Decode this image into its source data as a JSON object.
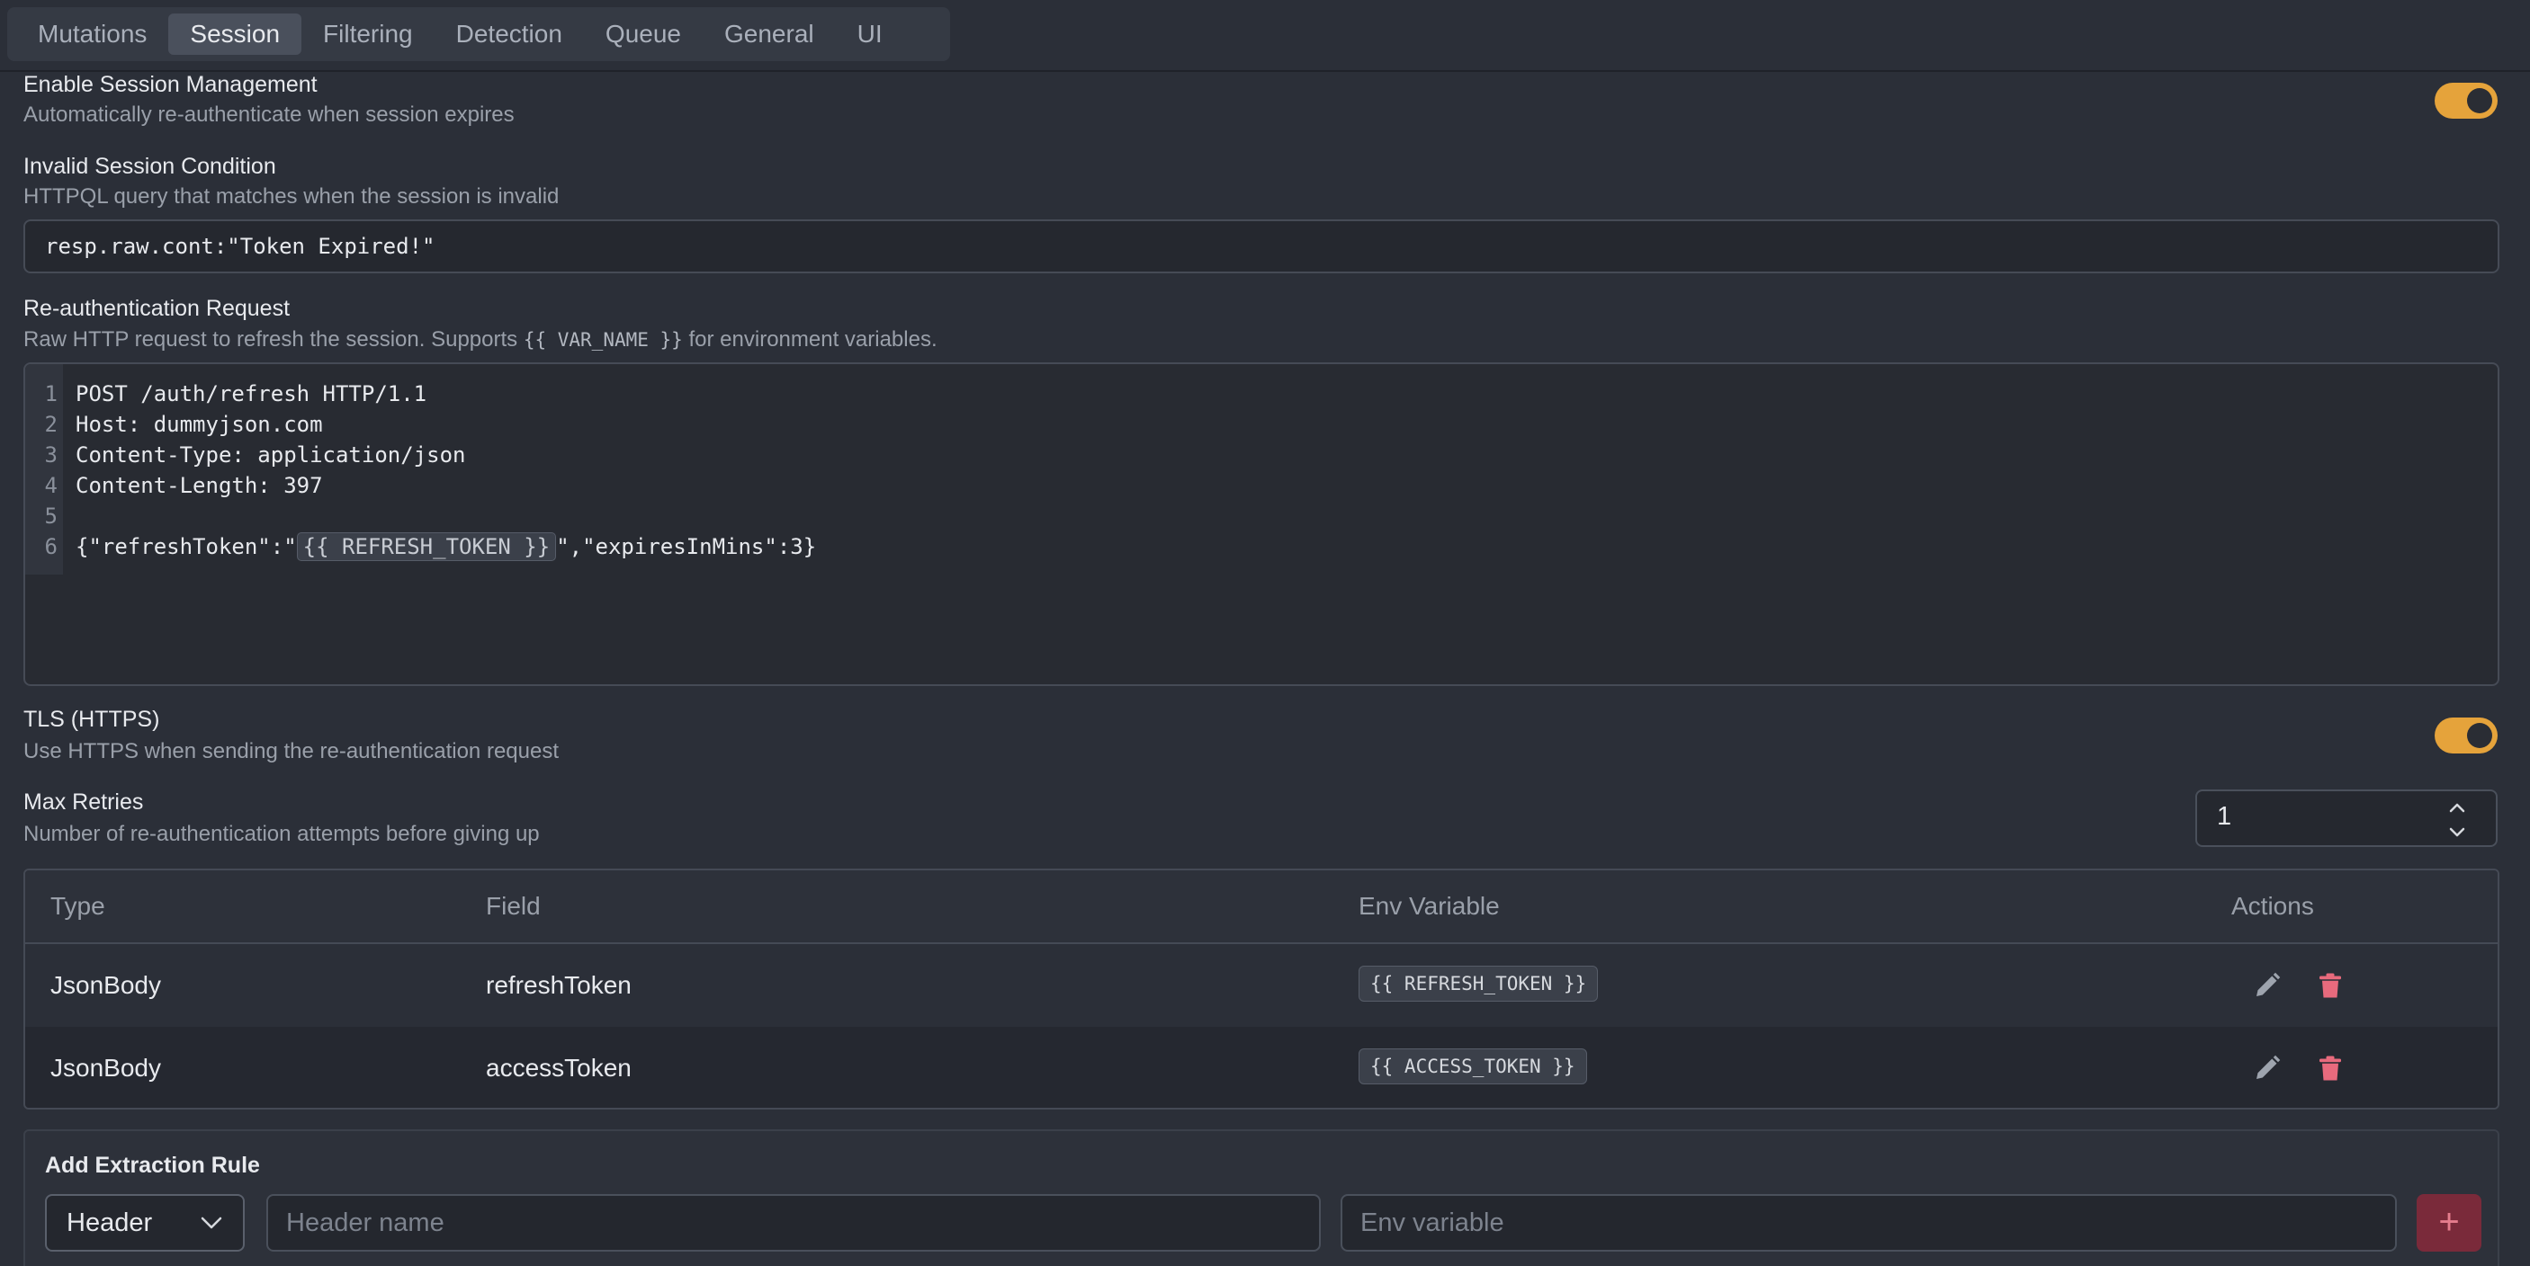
{
  "tabs": [
    "Mutations",
    "Session",
    "Filtering",
    "Detection",
    "Queue",
    "General",
    "UI"
  ],
  "active_tab": "Session",
  "session": {
    "enable": {
      "label": "Enable Session Management",
      "description": "Automatically re-authenticate when session expires",
      "on": true
    },
    "invalid_condition": {
      "label": "Invalid Session Condition",
      "description": "HTTPQL query that matches when the session is invalid",
      "value": "resp.raw.cont:\"Token Expired!\""
    },
    "reauth_request": {
      "label": "Re-authentication Request",
      "description_before": "Raw HTTP request to refresh the session. Supports ",
      "description_code": "{{ VAR_NAME }}",
      "description_after": " for environment variables.",
      "lines": [
        {
          "n": "1",
          "text": "POST /auth/refresh HTTP/1.1"
        },
        {
          "n": "2",
          "text": "Host: dummyjson.com"
        },
        {
          "n": "3",
          "text": "Content-Type: application/json"
        },
        {
          "n": "4",
          "text": "Content-Length: 397"
        },
        {
          "n": "5",
          "text": ""
        },
        {
          "n": "6",
          "before": "{\"refreshToken\":\"",
          "var": "{{ REFRESH_TOKEN }}",
          "after": "\",\"expiresInMins\":3}"
        }
      ]
    },
    "tls": {
      "label": "TLS (HTTPS)",
      "description": "Use HTTPS when sending the re-authentication request",
      "on": true
    },
    "max_retries": {
      "label": "Max Retries",
      "description": "Number of re-authentication attempts before giving up",
      "value": "1"
    }
  },
  "extraction_table": {
    "headers": {
      "type": "Type",
      "field": "Field",
      "env": "Env Variable",
      "actions": "Actions"
    },
    "rows": [
      {
        "type": "JsonBody",
        "field": "refreshToken",
        "env": "{{ REFRESH_TOKEN }}"
      },
      {
        "type": "JsonBody",
        "field": "accessToken",
        "env": "{{ ACCESS_TOKEN }}"
      }
    ]
  },
  "add_rule": {
    "title": "Add Extraction Rule",
    "source_type": "Header",
    "header_placeholder": "Header name",
    "env_placeholder": "Env variable",
    "add_label": "+"
  },
  "colors": {
    "accent_toggle": "#e5a33b",
    "delete_icon": "#e86a7d",
    "add_button": "#7a2a3a"
  }
}
